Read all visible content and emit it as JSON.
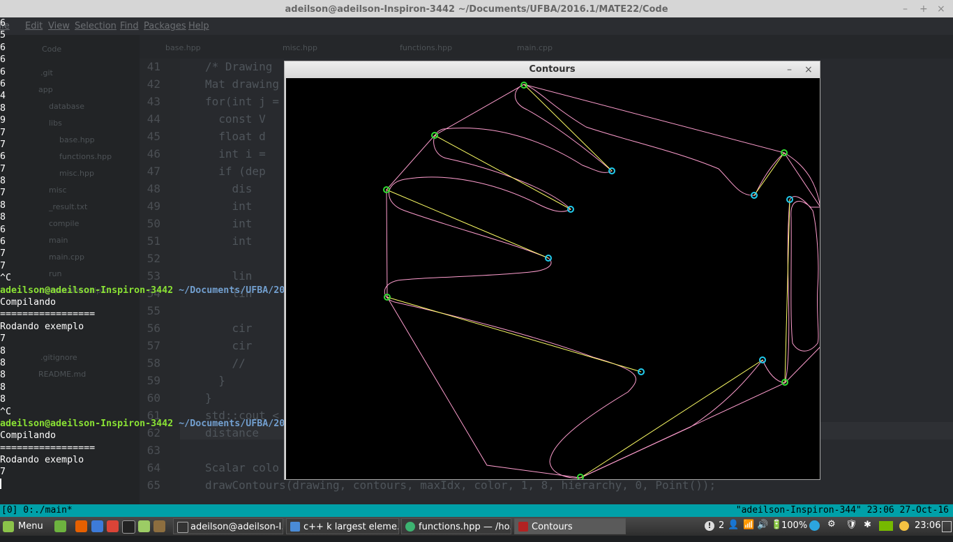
{
  "window": {
    "title": "adeilson@adeilson-Inspiron-3442 ~/Documents/UFBA/2016.1/MATE22/Code",
    "controls": [
      "–",
      "+",
      "×"
    ]
  },
  "atom": {
    "menu": [
      "File",
      "Edit",
      "View",
      "Selection",
      "Find",
      "Packages",
      "Help"
    ],
    "tree": [
      {
        "label": "Code"
      },
      {
        "label": ".git"
      },
      {
        "label": "app"
      },
      {
        "label": "database"
      },
      {
        "label": "libs"
      },
      {
        "label": "base.hpp"
      },
      {
        "label": "functions.hpp"
      },
      {
        "label": "misc.hpp"
      },
      {
        "label": "misc"
      },
      {
        "label": "_result.txt"
      },
      {
        "label": "compile"
      },
      {
        "label": "main"
      },
      {
        "label": "main.cpp"
      },
      {
        "label": "run"
      },
      {
        "label": "computeDescriptor"
      },
      {
        "label": ".gitignore"
      },
      {
        "label": "README.md"
      }
    ],
    "tabs": [
      "base.hpp",
      "misc.hpp",
      "functions.hpp",
      "main.cpp"
    ],
    "line_numbers": [
      "41",
      "42",
      "43",
      "44",
      "45",
      "46",
      "47",
      "48",
      "49",
      "50",
      "51",
      "52",
      "53",
      "54",
      "55",
      "56",
      "57",
      "58",
      "59",
      "60",
      "61",
      "62",
      "63",
      "64",
      "65"
    ],
    "code_lines": [
      "/* Drawing",
      "Mat drawing",
      "for(int j =",
      "  const V",
      "  float d",
      "  int i =",
      "  if (dep",
      "    dis",
      "    int",
      "    int",
      "    int",
      "",
      "    lin",
      "    lin",
      "",
      "    cir",
      "    cir",
      "    //",
      "  }",
      "}",
      "std::cout <",
      "distance",
      "",
      "Scalar colo",
      "drawContours(drawing, contours, maxIdx, color, 1, 8, hierarchy, 0, Point());"
    ]
  },
  "terminal": {
    "lines": [
      "6",
      "5",
      "6",
      "6",
      "6",
      "6",
      "4",
      "8",
      "9",
      "7",
      "7",
      "6",
      "7",
      "8",
      "7",
      "8",
      "8",
      "6",
      "6",
      "7",
      "7",
      "^C"
    ],
    "prompt_user": "adeilson@adeilson-Inspiron-3442",
    "prompt_path": " ~/Documents/UFBA/20",
    "block1": [
      "Compilando",
      "=================",
      "Rodando exemplo",
      "7",
      "8",
      "8",
      "8",
      "8",
      "8",
      "^C"
    ],
    "block2": [
      "Compilando",
      "=================",
      "Rodando exemplo",
      "7"
    ]
  },
  "tmux": {
    "left": "[0] 0:./main*",
    "right": "\"adeilson-Inspiron-344\" 23:06 27-Oct-16"
  },
  "contours_window": {
    "title": "Contours",
    "minimize": "–",
    "close": "×"
  },
  "taskbar": {
    "menu_label": "Menu",
    "tasks": [
      {
        "label": "adeilson@adeilson-I...",
        "active": false,
        "color": "#333333"
      },
      {
        "label": "c++ k largest eleme...",
        "active": false,
        "color": "#4a8bd6"
      },
      {
        "label": "functions.hpp — /ho...",
        "active": false,
        "color": "#3cb371"
      },
      {
        "label": "Contours",
        "active": true,
        "color": "#b22222"
      }
    ],
    "tray": {
      "notifications": "2",
      "battery": "100%",
      "clock": "23:06"
    }
  },
  "colors": {
    "contour": "#ff9ecf",
    "hull_line": "#ffff66",
    "hull_point": "#33dd33",
    "defect_point": "#22ccee",
    "prompt_user": "#8ae234",
    "prompt_path": "#729fcf",
    "tmux_bar": "#00a0a8"
  }
}
